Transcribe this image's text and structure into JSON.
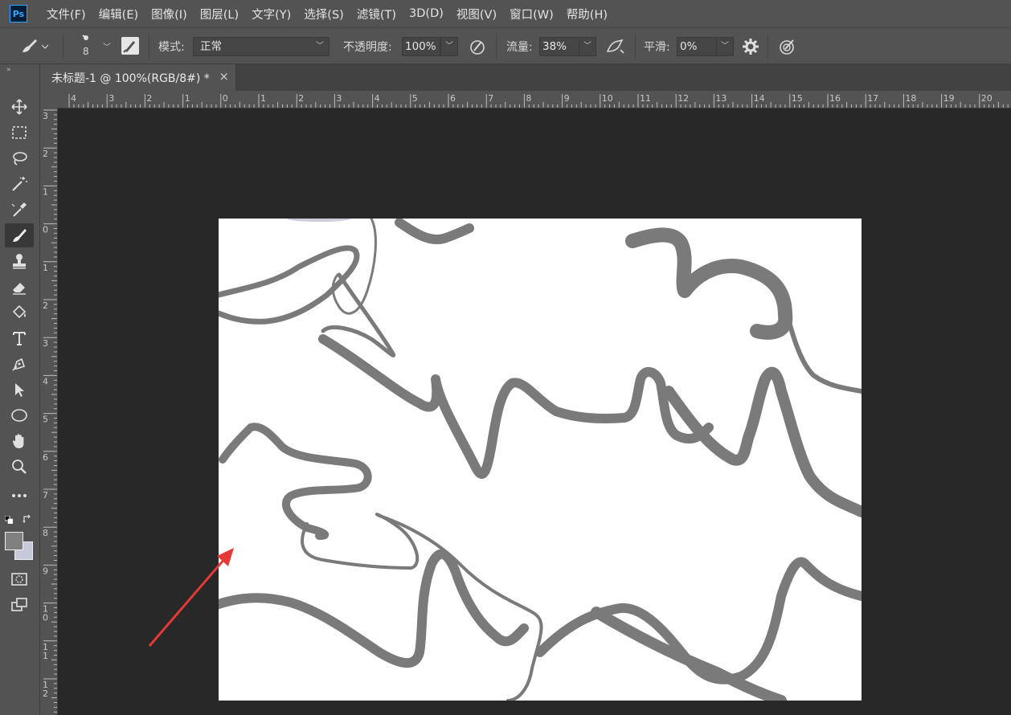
{
  "app": {
    "logo": "Ps"
  },
  "menu": [
    "文件(F)",
    "编辑(E)",
    "图像(I)",
    "图层(L)",
    "文字(Y)",
    "选择(S)",
    "滤镜(T)",
    "3D(D)",
    "视图(V)",
    "窗口(W)",
    "帮助(H)"
  ],
  "options": {
    "brush_size": "8",
    "mode_label": "模式:",
    "mode_value": "正常",
    "opacity_label": "不透明度:",
    "opacity_value": "100%",
    "flow_label": "流量:",
    "flow_value": "38%",
    "smooth_label": "平滑:",
    "smooth_value": "0%"
  },
  "document": {
    "tab_title": "未标题-1 @ 100%(RGB/8#) *",
    "close_glyph": "×"
  },
  "ruler": {
    "horizontal": [
      "4",
      "3",
      "2",
      "1",
      "0",
      "1",
      "2",
      "3",
      "4",
      "5",
      "6",
      "7",
      "8",
      "9",
      "10",
      "11",
      "12",
      "13",
      "14",
      "15",
      "16",
      "17",
      "18",
      "19",
      "20"
    ],
    "vertical": [
      "3",
      "2",
      "1",
      "0",
      "1",
      "2",
      "3",
      "4",
      "5",
      "6",
      "7",
      "8",
      "9",
      "1\n0",
      "1\n1",
      "1\n2"
    ]
  },
  "tools": [
    "move-icon",
    "marquee-icon",
    "lasso-icon",
    "magic-wand-icon",
    "eyedropper-icon",
    "brush-icon",
    "stamp-icon",
    "eraser-icon",
    "paint-bucket-icon",
    "type-icon",
    "pen-icon",
    "path-select-icon",
    "ellipse-icon",
    "hand-icon",
    "zoom-icon",
    "more-icon"
  ],
  "colors": {
    "foreground": "#808080",
    "background": "#c8c8dc",
    "stroke": "#7a7a7a",
    "arrow": "#e53935"
  }
}
